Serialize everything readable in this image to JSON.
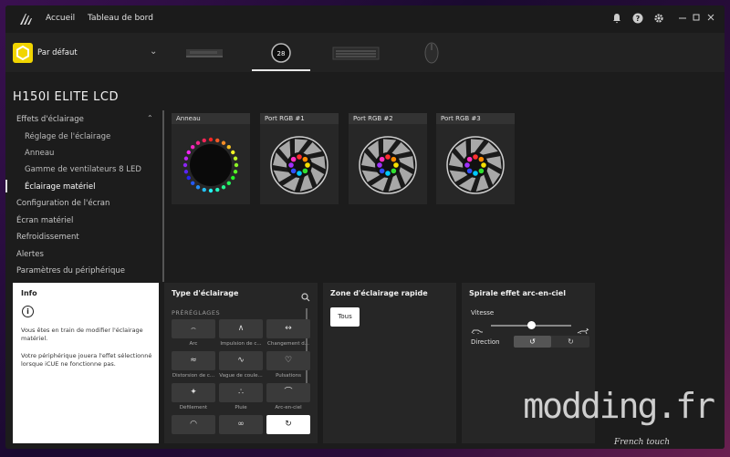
{
  "nav": {
    "home": "Accueil",
    "dashboard": "Tableau de bord"
  },
  "titlebar_icons": [
    "bell-icon",
    "help-icon",
    "gear-icon",
    "minimize-icon",
    "maximize-icon",
    "close-icon"
  ],
  "profile": {
    "name": "Par défaut"
  },
  "device_tabs": [
    "ram-device",
    "cooler-device",
    "keyboard-device",
    "mouse-device"
  ],
  "device_cooler_display": "28",
  "device": {
    "title": "H150I ELITE LCD"
  },
  "sidebar": {
    "items": [
      {
        "label": "Effets d'éclairage"
      },
      {
        "label": "Réglage de l'éclairage"
      },
      {
        "label": "Anneau"
      },
      {
        "label": "Gamme de ventilateurs 8 LED"
      },
      {
        "label": "Éclairage matériel"
      },
      {
        "label": "Configuration de l'écran"
      },
      {
        "label": "Écran matériel"
      },
      {
        "label": "Refroidissement"
      },
      {
        "label": "Alertes"
      },
      {
        "label": "Paramètres du périphérique"
      }
    ]
  },
  "ports": [
    {
      "label": "Anneau"
    },
    {
      "label": "Port RGB #1"
    },
    {
      "label": "Port RGB #2"
    },
    {
      "label": "Port RGB #3"
    }
  ],
  "info": {
    "title": "Info",
    "text1": "Vous êtes en train de modifier l'éclairage matériel.",
    "text2": "Votre périphérique jouera l'effet sélectionné lorsque iCUE ne fonctionne pas."
  },
  "lighting_type": {
    "title": "Type d'éclairage",
    "presets_label": "PRÉRÉGLAGES",
    "effects": [
      {
        "label": "Arc",
        "icon": "arc-icon"
      },
      {
        "label": "Impulsion de c...",
        "icon": "pulse-icon"
      },
      {
        "label": "Changement d...",
        "icon": "shift-icon"
      },
      {
        "label": "Distorsion de c...",
        "icon": "distortion-icon"
      },
      {
        "label": "Vague de coule...",
        "icon": "wave-icon"
      },
      {
        "label": "Pulsations",
        "icon": "heart-icon"
      },
      {
        "label": "Défilement",
        "icon": "scroll-icon"
      },
      {
        "label": "Pluie",
        "icon": "rain-icon"
      },
      {
        "label": "Arc-en-ciel",
        "icon": "rainbow-icon"
      },
      {
        "label": "",
        "icon": "gauge-icon"
      },
      {
        "label": "",
        "icon": "link-icon"
      },
      {
        "label": "",
        "icon": "spiral-icon"
      }
    ]
  },
  "quick_zone": {
    "title": "Zone d'éclairage rapide",
    "button": "Tous"
  },
  "spiral": {
    "title": "Spirale effet arc-en-ciel",
    "speed_label": "Vitesse",
    "speed_fraction": 0.5,
    "direction_label": "Direction"
  },
  "watermark": {
    "main": "modding.fr",
    "sub": "French touch"
  }
}
